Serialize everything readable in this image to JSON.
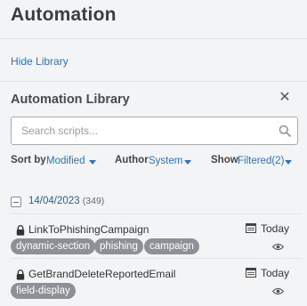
{
  "page": {
    "title": "Automation"
  },
  "library_toggle": {
    "label": "Hide Library"
  },
  "library": {
    "title": "Automation Library",
    "search_placeholder": "Search scripts..."
  },
  "filters": {
    "sort": {
      "label": "Sort by",
      "value": "Modified"
    },
    "author": {
      "label": "Author",
      "value": "System"
    },
    "show": {
      "label": "Show",
      "value": "Filtered(2)"
    }
  },
  "group": {
    "date": "14/04/2023",
    "count": "(349)"
  },
  "scripts": [
    {
      "name": "LinkToPhishingCampaign",
      "date": "Today",
      "tags": [
        "dynamic-section",
        "phishing",
        "campaign"
      ]
    },
    {
      "name": "GetBrandDeleteReportedEmail",
      "date": "Today",
      "tags": [
        "field-display"
      ]
    }
  ],
  "colors": {
    "accent": "#2e73b8",
    "tag": "#8d9196"
  }
}
